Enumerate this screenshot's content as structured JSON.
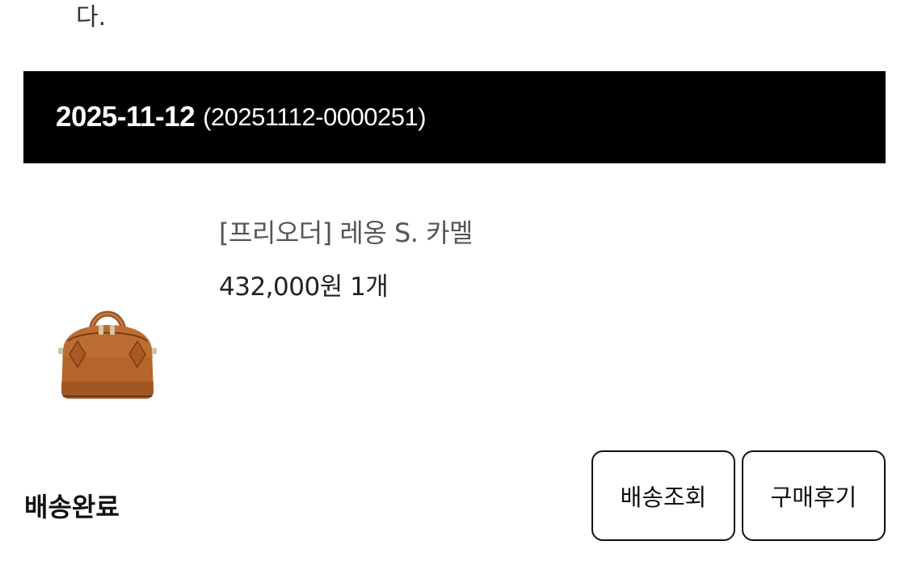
{
  "previous_text_tail": "다.",
  "order": {
    "date": "2025-11-12",
    "number": "(20251112-0000251)"
  },
  "product": {
    "image_icon": "brown-handbag-image",
    "name": "[프리오더] 레옹 S. 카멜",
    "price_qty": "432,000원 1개"
  },
  "status": {
    "label": "배송완료"
  },
  "actions": {
    "track_label": "배송조회",
    "review_label": "구매후기"
  },
  "colors": {
    "header_bg": "#000000",
    "header_text": "#ffffff",
    "bag_body": "#b5642a"
  }
}
